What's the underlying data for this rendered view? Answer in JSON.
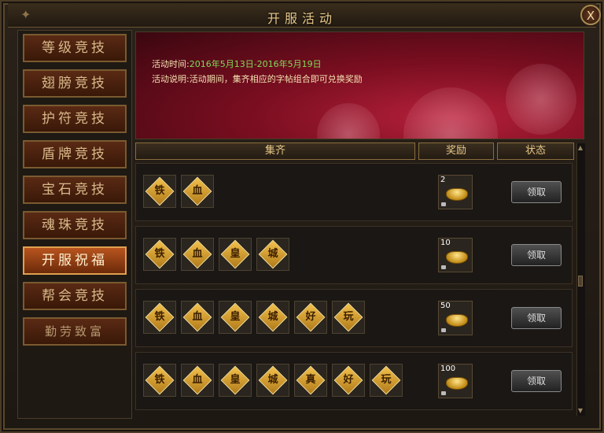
{
  "window": {
    "title": "开服活动",
    "close_label": "X"
  },
  "sidebar": {
    "items": [
      {
        "label": "等级竞技",
        "active": false
      },
      {
        "label": "翅膀竞技",
        "active": false
      },
      {
        "label": "护符竞技",
        "active": false
      },
      {
        "label": "盾牌竞技",
        "active": false
      },
      {
        "label": "宝石竞技",
        "active": false
      },
      {
        "label": "魂珠竞技",
        "active": false
      },
      {
        "label": "开服祝福",
        "active": true
      },
      {
        "label": "帮会竞技",
        "active": false
      },
      {
        "label": "勤劳致富",
        "active": false
      }
    ]
  },
  "banner": {
    "time_label": "活动时间:",
    "time_value": "2016年5月13日-2016年5月19日",
    "desc_label": "活动说明:",
    "desc_value": "活动期间，集齐相应的字帖组合即可兑换奖励"
  },
  "table": {
    "headers": {
      "collect": "集齐",
      "reward": "奖励",
      "status": "状态"
    },
    "rows": [
      {
        "chars": [
          "铁",
          "血"
        ],
        "reward_count": "2",
        "button": "领取"
      },
      {
        "chars": [
          "铁",
          "血",
          "皇",
          "城"
        ],
        "reward_count": "10",
        "button": "领取"
      },
      {
        "chars": [
          "铁",
          "血",
          "皇",
          "城",
          "好",
          "玩"
        ],
        "reward_count": "50",
        "button": "领取"
      },
      {
        "chars": [
          "铁",
          "血",
          "皇",
          "城",
          "真",
          "好",
          "玩"
        ],
        "reward_count": "100",
        "button": "领取"
      }
    ]
  },
  "icons": {
    "reward_item": "gold-ingot-icon",
    "lock": "lock-icon",
    "char_tile": "diamond-char-icon"
  },
  "colors": {
    "accent": "#e8c98a",
    "active_tab": "#b8541e",
    "date_text": "#7fdc5a"
  }
}
